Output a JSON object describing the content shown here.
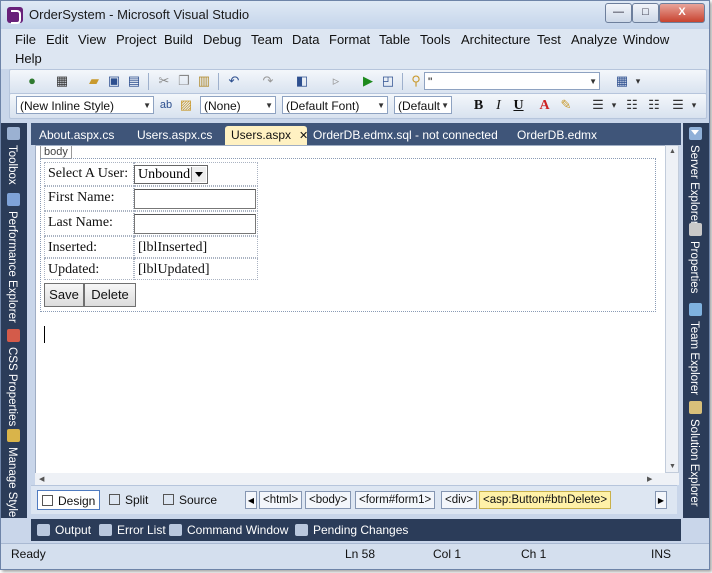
{
  "window": {
    "title": "OrderSystem - Microsoft Visual Studio",
    "minimize": "—",
    "maximize": "□",
    "close": "X"
  },
  "menu": [
    "File",
    "Edit",
    "View",
    "Project",
    "Build",
    "Debug",
    "Team",
    "Data",
    "Format",
    "Table",
    "Tools",
    "Architecture",
    "Test",
    "Analyze",
    "Window",
    "Help"
  ],
  "toolbar1": {
    "search_combo": "\""
  },
  "toolbar2": {
    "style_combo": "(New Inline Style)",
    "class_combo": "(None)",
    "font_combo": "(Default Font)",
    "size_combo": "(Default",
    "bold": "B",
    "italic": "I",
    "underline": "U",
    "font_color": "A"
  },
  "left_panels": [
    "Toolbox",
    "Performance Explorer",
    "CSS Properties",
    "Manage Style"
  ],
  "right_panels": [
    "Server Explorer",
    "Properties",
    "Team Explorer",
    "Solution Explorer"
  ],
  "doc_tabs": [
    {
      "label": "About.aspx.cs"
    },
    {
      "label": "Users.aspx.cs"
    },
    {
      "label": "Users.aspx",
      "active": true
    },
    {
      "label": "OrderDB.edmx.sql - not connected"
    },
    {
      "label": "OrderDB.edmx"
    }
  ],
  "design": {
    "body_tag": "body",
    "rows": [
      {
        "label": "Select A User:"
      },
      {
        "label": "First Name:"
      },
      {
        "label": "Last Name:"
      },
      {
        "label": "Inserted:",
        "value": "[lblInserted]"
      },
      {
        "label": "Updated:",
        "value": "[lblUpdated]"
      }
    ],
    "user_dropdown": "Unbound",
    "save_label": "Save",
    "delete_label": "Delete"
  },
  "view_bar": {
    "design": "Design",
    "split": "Split",
    "source": "Source",
    "breadcrumbs": [
      "<html>",
      "<body>",
      "<form#form1>",
      "<div>",
      "<asp:Button#btnDelete>"
    ]
  },
  "tool_windows": [
    "Output",
    "Error List",
    "Command Window",
    "Pending Changes"
  ],
  "status": {
    "ready": "Ready",
    "line": "Ln 58",
    "col": "Col 1",
    "ch": "Ch 1",
    "ins": "INS"
  },
  "colors": {
    "panel_dark": "#2b3c59",
    "active_tab": "#fff1c2",
    "chrome": "#c9d6ea"
  }
}
